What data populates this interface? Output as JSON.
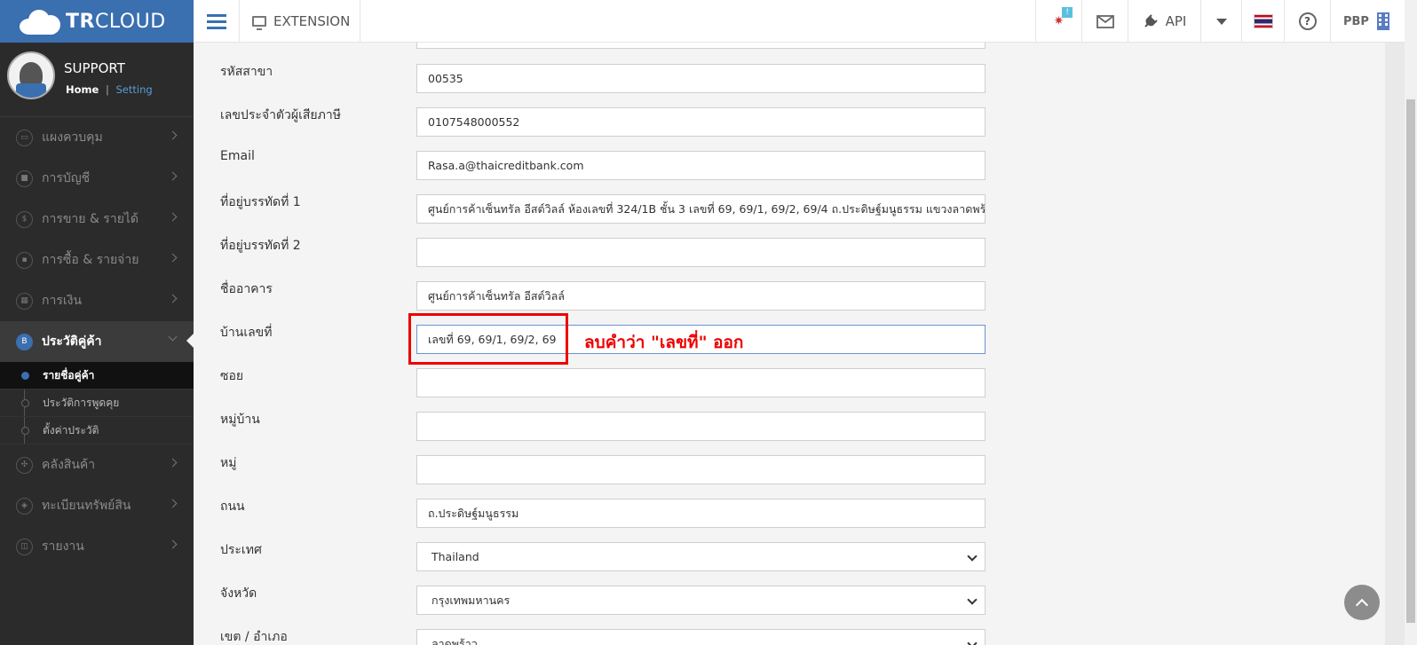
{
  "header": {
    "logo_bold": "TR",
    "logo_rest": "CLOUD",
    "extension_label": "EXTENSION",
    "badge": "!",
    "api_label": "API",
    "user_label": "PBP"
  },
  "profile": {
    "name": "SUPPORT",
    "home": "Home",
    "separator": "|",
    "setting": "Setting"
  },
  "sidebar": {
    "items": [
      {
        "label": "แผงควบคุม",
        "icon": "▭"
      },
      {
        "label": "การบัญชี",
        "icon": "■"
      },
      {
        "label": "การขาย & รายได้",
        "icon": "$"
      },
      {
        "label": "การซื้อ & รายจ่าย",
        "icon": "▪"
      },
      {
        "label": "การเงิน",
        "icon": "▦"
      },
      {
        "label": "ประวัติคู่ค้า",
        "icon": "B"
      },
      {
        "label": "คลังสินค้า",
        "icon": "✣"
      },
      {
        "label": "ทะเบียนทรัพย์สิน",
        "icon": "◈"
      },
      {
        "label": "รายงาน",
        "icon": "◫"
      }
    ],
    "subitems": [
      {
        "label": "รายชื่อคู่ค้า"
      },
      {
        "label": "ประวัติการพูดคุย"
      },
      {
        "label": "ตั้งค่าประวัติ"
      }
    ]
  },
  "form": {
    "branch_code_label": "รหัสสาขา",
    "branch_code": "00535",
    "tax_id_label": "เลขประจำตัวผู้เสียภาษี",
    "tax_id": "0107548000552",
    "email_label": "Email",
    "email": "Rasa.a@thaicreditbank.com",
    "address1_label": "ที่อยู่บรรทัดที่ 1",
    "address1": "ศูนย์การค้าเซ็นทรัล อีสต์วิลล์ ห้องเลขที่ 324/1B ชั้น 3 เลขที่ 69, 69/1, 69/2, 69/4 ถ.ประดิษฐ์มนูธรรม แขวงลาดพร้าว",
    "address2_label": "ที่อยู่บรรทัดที่ 2",
    "address2": "",
    "building_label": "ชื่ออาคาร",
    "building": "ศูนย์การค้าเซ็นทรัล อีสต์วิลล์",
    "house_no_label": "บ้านเลขที่",
    "house_no": "เลขที่ 69, 69/1, 69/2, 69",
    "soi_label": "ซอย",
    "soi": "",
    "village_label": "หมู่บ้าน",
    "village": "",
    "moo_label": "หมู่",
    "moo": "",
    "road_label": "ถนน",
    "road": "ถ.ประดิษฐ์มนูธรรม",
    "country_label": "ประเทศ",
    "country": "Thailand",
    "province_label": "จังหวัด",
    "province": "กรุงเทพมหานคร",
    "district_label": "เขต / อำเภอ",
    "district": "ลาดพร้าว"
  },
  "annotation": {
    "text": "ลบคำว่า \"เลขที่\" ออก",
    "color": "#e00000"
  }
}
